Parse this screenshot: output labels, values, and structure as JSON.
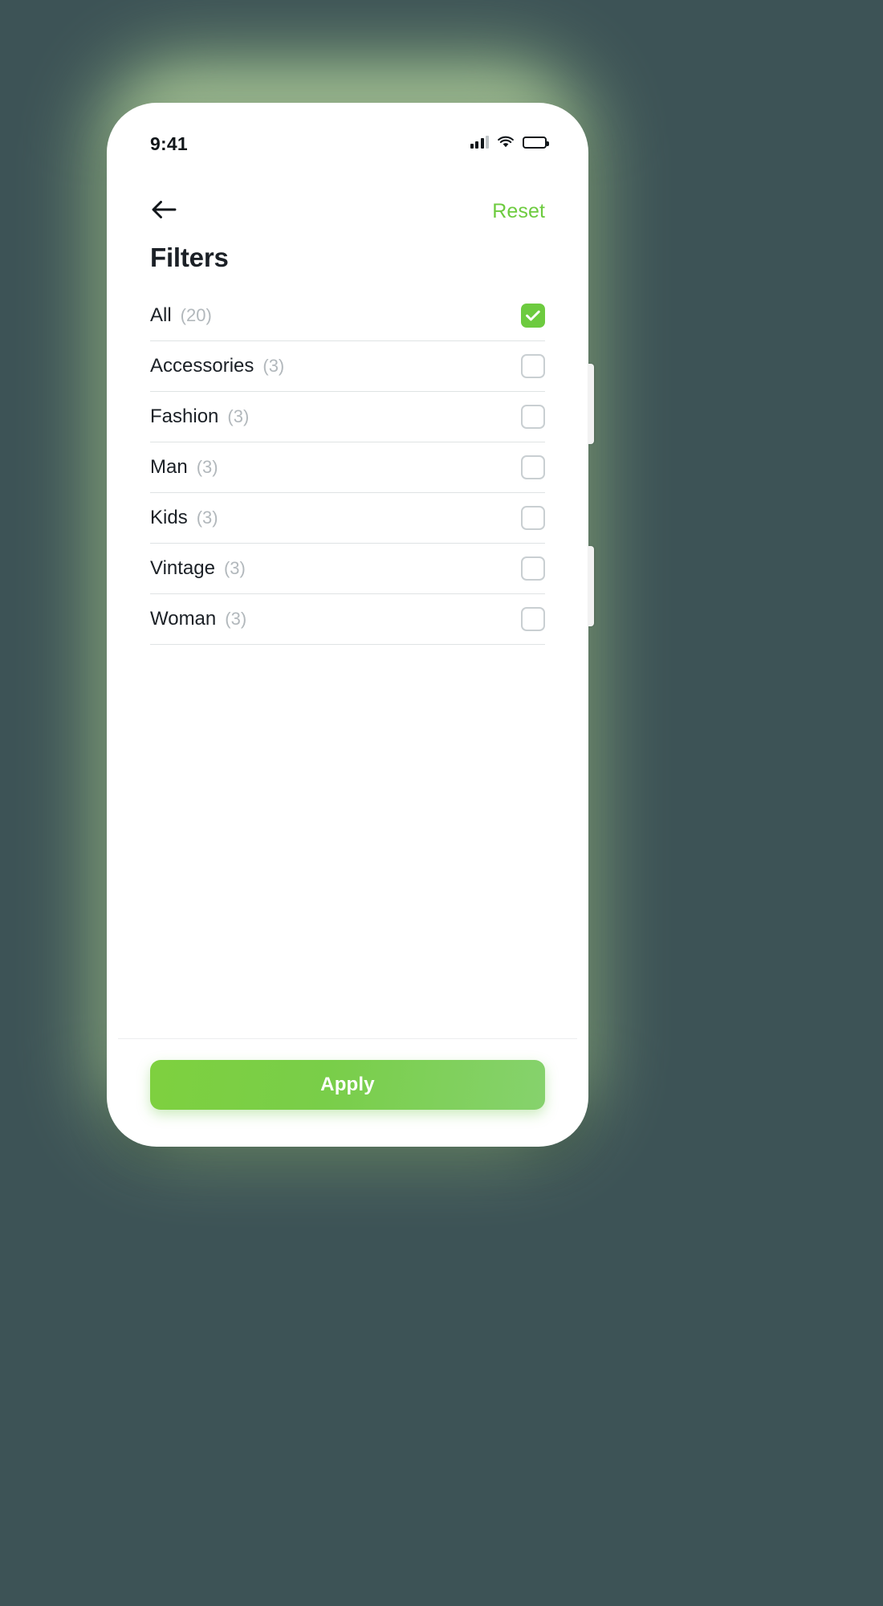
{
  "theme": {
    "backdrop": "#3d5356",
    "glow": "#8fb184",
    "accent": "#6dcb3f",
    "text_primary": "#1b2026",
    "text_muted": "#b2b8bc",
    "divider": "#dfe3e4"
  },
  "status_bar": {
    "time": "9:41",
    "signal_icon": "cellular-signal-icon",
    "wifi_icon": "wifi-icon",
    "battery_icon": "battery-icon"
  },
  "nav": {
    "back_icon": "arrow-left-icon",
    "reset_label": "Reset"
  },
  "header": {
    "title": "Filters"
  },
  "filters": [
    {
      "name": "All",
      "count": "(20)",
      "checked": true
    },
    {
      "name": "Accessories",
      "count": "(3)",
      "checked": false
    },
    {
      "name": "Fashion",
      "count": "(3)",
      "checked": false
    },
    {
      "name": "Man",
      "count": "(3)",
      "checked": false
    },
    {
      "name": "Kids",
      "count": "(3)",
      "checked": false
    },
    {
      "name": "Vintage",
      "count": "(3)",
      "checked": false
    },
    {
      "name": "Woman",
      "count": "(3)",
      "checked": false
    }
  ],
  "footer": {
    "apply_label": "Apply"
  }
}
